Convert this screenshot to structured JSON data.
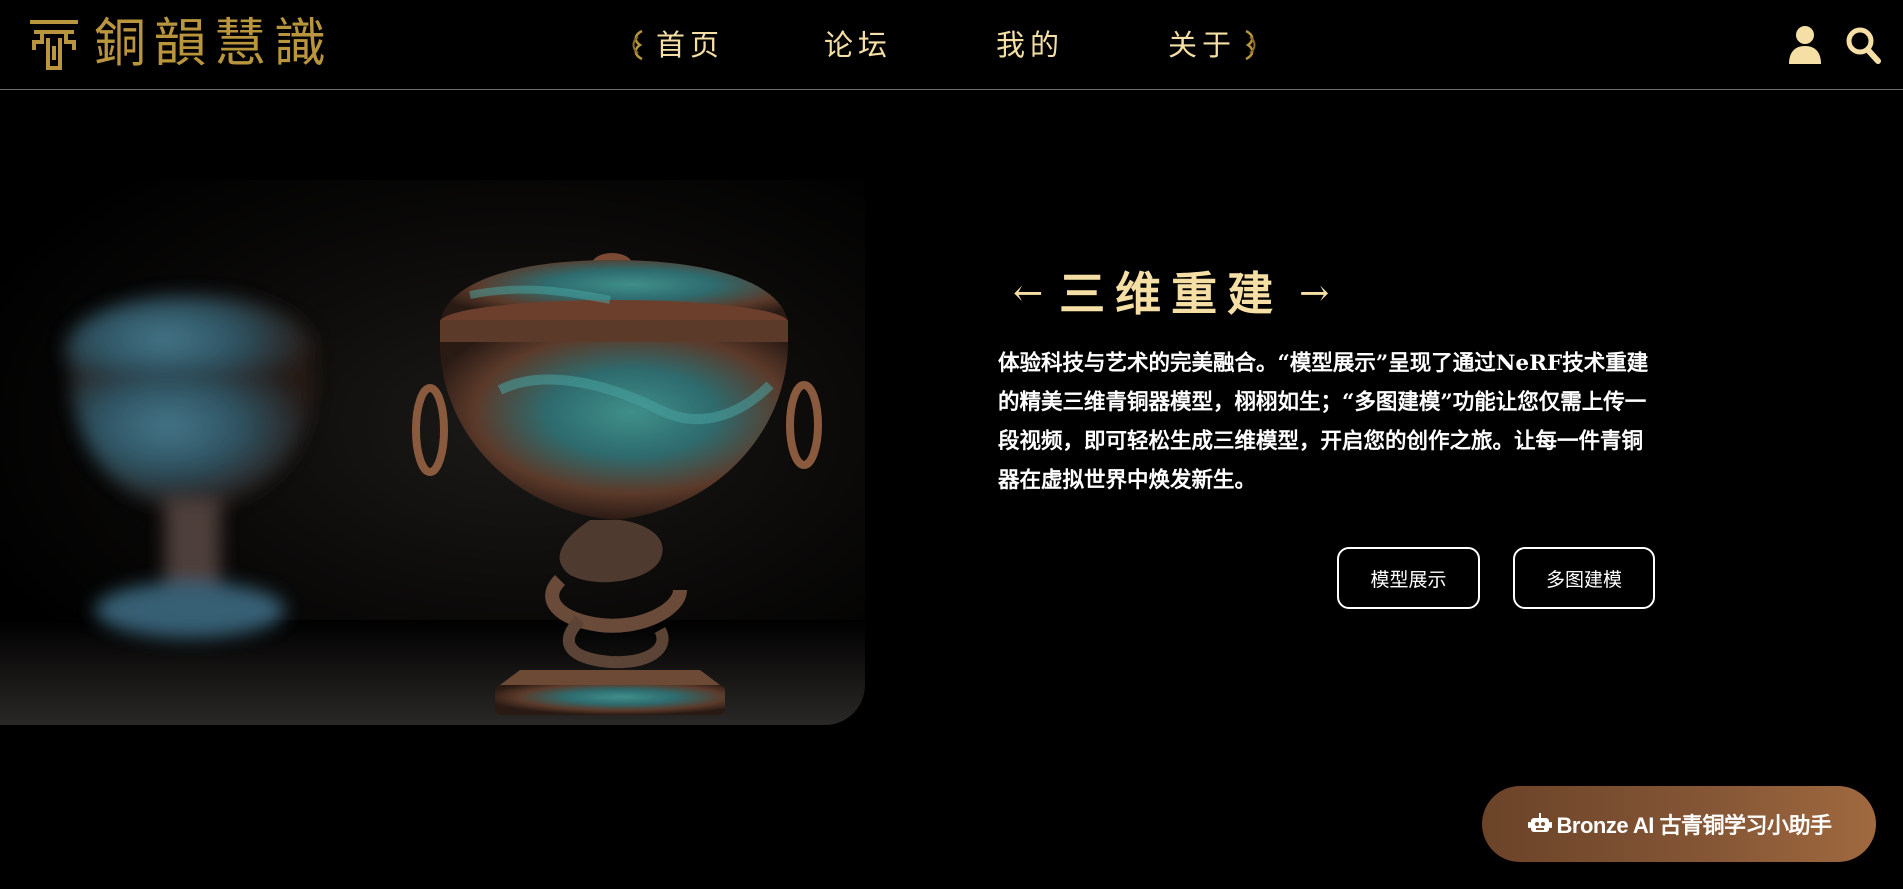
{
  "brand": {
    "title": "銅韻慧識",
    "accent": "#b9953d"
  },
  "nav": {
    "items": [
      {
        "label": "首页"
      },
      {
        "label": "论坛"
      },
      {
        "label": "我的"
      },
      {
        "label": "关于"
      }
    ],
    "color": "#f5dfa4"
  },
  "header_icons": [
    "user-icon",
    "search-icon"
  ],
  "hero": {
    "title": "三维重建",
    "prev_arrow": "←",
    "next_arrow": "→",
    "description": "体验科技与艺术的完美融合。“模型展示”呈现了通过NeRF技术重建的精美三维青铜器模型，栩栩如生；“多图建模”功能让您仅需上传一段视频，即可轻松生成三维模型，开启您的创作之旅。让每一件青铜器在虚拟世界中焕发新生。",
    "buttons": {
      "model_display": "模型展示",
      "multi_image": "多图建模"
    }
  },
  "assistant": {
    "label": "Bronze AI 古青铜学习小助手",
    "icon": "robot-icon"
  }
}
